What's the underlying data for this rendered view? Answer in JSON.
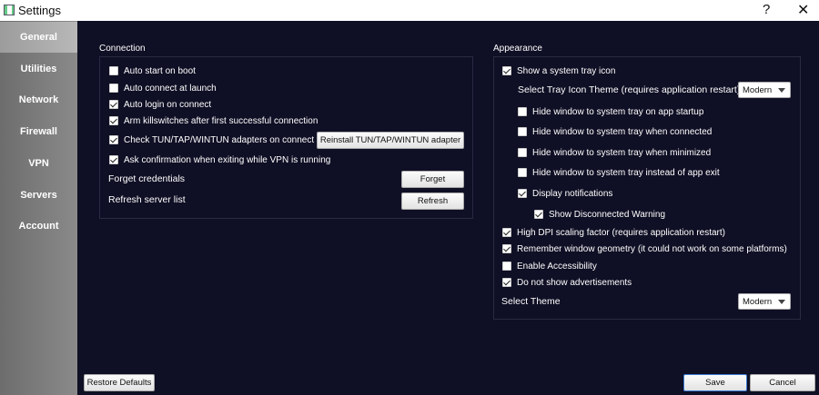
{
  "window": {
    "title": "Settings",
    "help_label": "?",
    "close_label": "✕"
  },
  "sidebar": {
    "items": [
      {
        "label": "General",
        "active": true
      },
      {
        "label": "Utilities"
      },
      {
        "label": "Network"
      },
      {
        "label": "Firewall"
      },
      {
        "label": "VPN"
      },
      {
        "label": "Servers"
      },
      {
        "label": "Account"
      }
    ]
  },
  "connection": {
    "title": "Connection",
    "auto_start": {
      "label": "Auto start on boot",
      "checked": false
    },
    "auto_connect": {
      "label": "Auto connect at launch",
      "checked": false
    },
    "auto_login": {
      "label": "Auto login on connect",
      "checked": true
    },
    "killswitch": {
      "label": "Arm killswitches after first successful connection",
      "checked": true
    },
    "check_tun": {
      "label": "Check TUN/TAP/WINTUN adapters on connect",
      "checked": true
    },
    "reinstall_label": "Reinstall TUN/TAP/WINTUN adapter",
    "ask_confirm": {
      "label": "Ask confirmation when exiting while VPN is running",
      "checked": true
    },
    "forget_label": "Forget credentials",
    "forget_button": "Forget",
    "refresh_label": "Refresh server list",
    "refresh_button": "Refresh"
  },
  "appearance": {
    "title": "Appearance",
    "tray_icon": {
      "label": "Show a system tray icon",
      "checked": true
    },
    "tray_theme_label": "Select Tray Icon Theme (requires application restart)",
    "tray_theme_value": "Modern",
    "hide_startup": {
      "label": "Hide window to system tray on app startup",
      "checked": false
    },
    "hide_connected": {
      "label": "Hide window to system tray when connected",
      "checked": false
    },
    "hide_minimized": {
      "label": "Hide window to system tray when minimized",
      "checked": false
    },
    "hide_exit": {
      "label": "Hide window to system tray instead of app exit",
      "checked": false
    },
    "display_notifications": {
      "label": "Display notifications",
      "checked": true
    },
    "show_disconnected": {
      "label": "Show Disconnected Warning",
      "checked": true
    },
    "high_dpi": {
      "label": "High DPI scaling factor (requires application restart)",
      "checked": true
    },
    "remember_geometry": {
      "label": "Remember window geometry (it could not work on some platforms)",
      "checked": true
    },
    "accessibility": {
      "label": "Enable Accessibility",
      "checked": false
    },
    "no_ads": {
      "label": "Do not show advertisements",
      "checked": true
    },
    "theme_label": "Select Theme",
    "theme_value": "Modern"
  },
  "footer": {
    "restore_label": "Restore Defaults",
    "save_label": "Save",
    "cancel_label": "Cancel"
  }
}
